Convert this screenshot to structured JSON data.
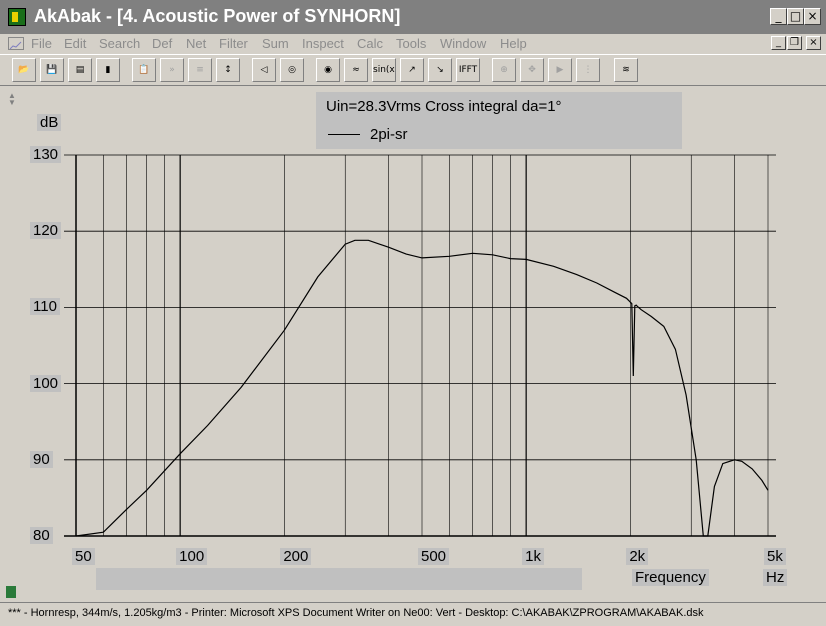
{
  "window": {
    "title": "AkAbak - [4. Acoustic Power of SYNHORN]",
    "controls": {
      "minimize": "_",
      "maximize": "□",
      "close": "×"
    }
  },
  "menu": {
    "items": [
      "File",
      "Edit",
      "Search",
      "Def",
      "Net",
      "Filter",
      "Sum",
      "Inspect",
      "Calc",
      "Tools",
      "Window",
      "Help"
    ]
  },
  "toolbar": {
    "buttons": [
      {
        "icon": "open-folder-icon",
        "enabled": true,
        "text": ""
      },
      {
        "icon": "save-disk-icon",
        "enabled": true,
        "text": ""
      },
      {
        "icon": "network-icon",
        "enabled": true,
        "text": ""
      },
      {
        "icon": "driver-params-icon",
        "enabled": true,
        "text": ""
      },
      {
        "icon": "clipboard-icon",
        "enabled": true,
        "text": ""
      },
      {
        "icon": "trace-icon",
        "enabled": false,
        "text": ""
      },
      {
        "icon": "step-icon",
        "enabled": false,
        "text": ""
      },
      {
        "icon": "axis-scale-icon",
        "enabled": true,
        "text": ""
      },
      {
        "icon": "speaker-icon",
        "enabled": true,
        "text": ""
      },
      {
        "icon": "xy-plot-icon",
        "enabled": true,
        "text": ""
      },
      {
        "icon": "probe-icon",
        "enabled": true,
        "text": ""
      },
      {
        "icon": "sweep-icon",
        "enabled": true,
        "text": ""
      },
      {
        "icon": "sinx-icon",
        "enabled": true,
        "text": "sin(x)"
      },
      {
        "icon": "response-icon",
        "enabled": true,
        "text": ""
      },
      {
        "icon": "response-dots-icon",
        "enabled": true,
        "text": ""
      },
      {
        "icon": "ifft-icon",
        "enabled": true,
        "text": "IFFT"
      },
      {
        "icon": "zoom-icon",
        "enabled": false,
        "text": ""
      },
      {
        "icon": "pan-icon",
        "enabled": false,
        "text": ""
      },
      {
        "icon": "play-icon",
        "enabled": false,
        "text": ""
      },
      {
        "icon": "marker-icon",
        "enabled": false,
        "text": ""
      },
      {
        "icon": "overlay-icon",
        "enabled": true,
        "text": ""
      }
    ]
  },
  "legend": {
    "title": "Uin=28.3Vrms Cross integral da=1°",
    "series_label": "2pi-sr"
  },
  "status": {
    "text": "*** - Hornresp, 344m/s, 1.205kg/m3 - Printer: Microsoft XPS Document Writer on Ne00: Vert - Desktop: C:\\AKABAK\\ZPROGRAM\\AKABAK.dsk"
  },
  "chart_data": {
    "type": "line",
    "x_scale": "log",
    "xlim": [
      50,
      5000
    ],
    "ylim": [
      80,
      130
    ],
    "ylabel": "dB",
    "xlabel": "Frequency",
    "xunit": "Hz",
    "y_ticks": [
      "130",
      "120",
      "110",
      "100",
      "90",
      "80"
    ],
    "x_ticks": [
      {
        "value": 50,
        "label": "50"
      },
      {
        "value": 100,
        "label": "100"
      },
      {
        "value": 200,
        "label": "200"
      },
      {
        "value": 500,
        "label": "500"
      },
      {
        "value": 1000,
        "label": "1k"
      },
      {
        "value": 2000,
        "label": "2k"
      },
      {
        "value": 5000,
        "label": "5k"
      }
    ],
    "grid": true,
    "colors": {
      "line": "#000000",
      "grid": "#000000",
      "background": "#d4d0c8"
    },
    "series": [
      {
        "name": "2pi-sr",
        "x": [
          50,
          60,
          70,
          80,
          100,
          120,
          150,
          200,
          250,
          300,
          320,
          350,
          400,
          450,
          500,
          600,
          700,
          800,
          900,
          1000,
          1200,
          1400,
          1600,
          1800,
          1950,
          2020,
          2040,
          2060,
          2080,
          2100,
          2150,
          2300,
          2500,
          2700,
          2900,
          3100,
          3250,
          3350,
          3500,
          3700,
          4000,
          4200,
          4500,
          4800,
          5000
        ],
        "y": [
          80,
          80.5,
          83.5,
          86,
          90.8,
          94.5,
          99.5,
          107,
          114,
          118.3,
          118.8,
          118.8,
          117.9,
          117,
          116.5,
          116.7,
          117.1,
          116.9,
          116.4,
          116.3,
          115.4,
          114.3,
          113.2,
          112,
          111.2,
          110.5,
          101,
          110.2,
          110.3,
          110.1,
          109.7,
          108.8,
          107.5,
          104.5,
          98.5,
          90,
          80,
          80,
          86.5,
          89.5,
          90,
          89.8,
          88.8,
          87.3,
          86
        ]
      }
    ]
  }
}
